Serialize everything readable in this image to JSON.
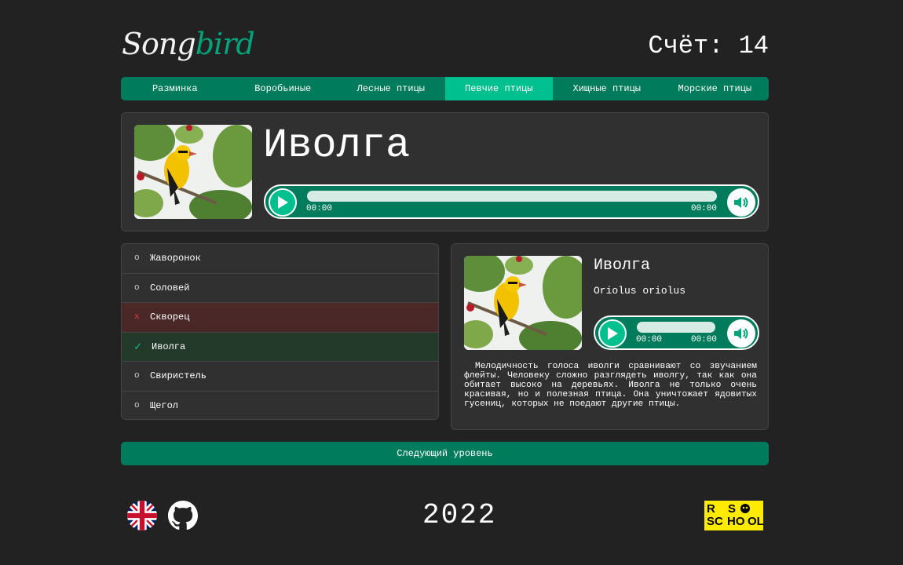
{
  "header": {
    "logo_part1": "Song",
    "logo_part2": "bird",
    "score": "Счёт: 14"
  },
  "nav": {
    "items": [
      "Разминка",
      "Воробьиные",
      "Лесные птицы",
      "Певчие птицы",
      "Хищные птицы",
      "Морские птицы"
    ],
    "active_index": 3
  },
  "current": {
    "name": "Иволга",
    "time_current": "00:00",
    "time_duration": "00:00"
  },
  "answers": [
    {
      "mark": "o",
      "label": "Жаворонок",
      "state": "neutral"
    },
    {
      "mark": "o",
      "label": "Соловей",
      "state": "neutral"
    },
    {
      "mark": "x",
      "label": "Скворец",
      "state": "wrong"
    },
    {
      "mark": "✓",
      "label": "Иволга",
      "state": "right"
    },
    {
      "mark": "o",
      "label": "Свиристель",
      "state": "neutral"
    },
    {
      "mark": "o",
      "label": "Щегол",
      "state": "neutral"
    }
  ],
  "info": {
    "name": "Иволга",
    "latin": "Oriolus oriolus",
    "time_current": "00:00",
    "time_duration": "00:00",
    "description": "Мелодичность голоса иволги сравнивают со звучанием флейты. Человеку сложно разглядеть иволгу, так как она обитает высоко на деревьях. Иволга не только очень красивая, но и полезная птица. Она уничтожает ядовитых гусениц, которых не поедают другие птицы."
  },
  "next_button": "Следующий уровень",
  "footer": {
    "year": "2022",
    "rs_logo": "RS SCHOOL"
  },
  "colors": {
    "background": "#222222",
    "accent": "#007b5b",
    "accent_active": "#00c08f",
    "panel": "#303030",
    "wrong": "#e03a3a"
  },
  "icons": [
    "play-icon",
    "volume-icon",
    "uk-flag-icon",
    "github-icon"
  ]
}
